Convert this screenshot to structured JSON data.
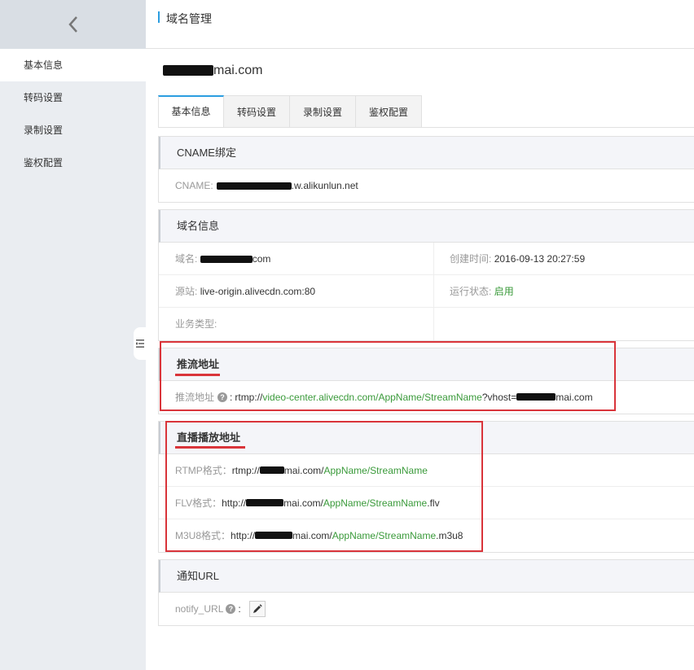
{
  "sidebar": {
    "items": [
      {
        "label": "基本信息"
      },
      {
        "label": "转码设置"
      },
      {
        "label": "录制设置"
      },
      {
        "label": "鉴权配置"
      }
    ]
  },
  "header": {
    "title": "域名管理"
  },
  "domain": {
    "suffix": "mai.com"
  },
  "tabs": [
    {
      "label": "基本信息"
    },
    {
      "label": "转码设置"
    },
    {
      "label": "录制设置"
    },
    {
      "label": "鉴权配置"
    }
  ],
  "cname": {
    "title": "CNAME绑定",
    "label": "CNAME:",
    "value_suffix": ".w.alikunlun.net"
  },
  "domain_info": {
    "title": "域名信息",
    "domain_label": "域名:",
    "domain_suffix": "com",
    "created_label": "创建时间:",
    "created_value": "2016-09-13 20:27:59",
    "origin_label": "源站:",
    "origin_value": "live-origin.alivecdn.com:80",
    "status_label": "运行状态:",
    "status_value": "启用",
    "biz_label": "业务类型:"
  },
  "push": {
    "title": "推流地址",
    "label": "推流地址",
    "help": "?",
    "colon": ":",
    "prefix": "rtmp://",
    "host": "video-center.alivecdn.com/AppName/StreamName",
    "query": "?vhost=",
    "suffix": "mai.com"
  },
  "play": {
    "title": "直播播放地址",
    "rtmp_label": "RTMP格式：",
    "rtmp_prefix": "rtmp://",
    "rtmp_host": "mai.com/",
    "rtmp_path": "AppName/StreamName",
    "flv_label": "FLV格式：",
    "flv_prefix": "http://",
    "flv_host": "mai.com/",
    "flv_path": "AppName/StreamName",
    "flv_ext": ".flv",
    "m3u8_label": "M3U8格式：",
    "m3u8_prefix": "http://",
    "m3u8_host": "mai.com/",
    "m3u8_path": "AppName/StreamName",
    "m3u8_ext": ".m3u8"
  },
  "notify": {
    "title": "通知URL",
    "label": "notify_URL",
    "help": "?",
    "colon": ":"
  },
  "colors": {
    "accent": "#2b9de0",
    "link_green": "#3a9a3a",
    "highlight_red": "#d9343a"
  }
}
